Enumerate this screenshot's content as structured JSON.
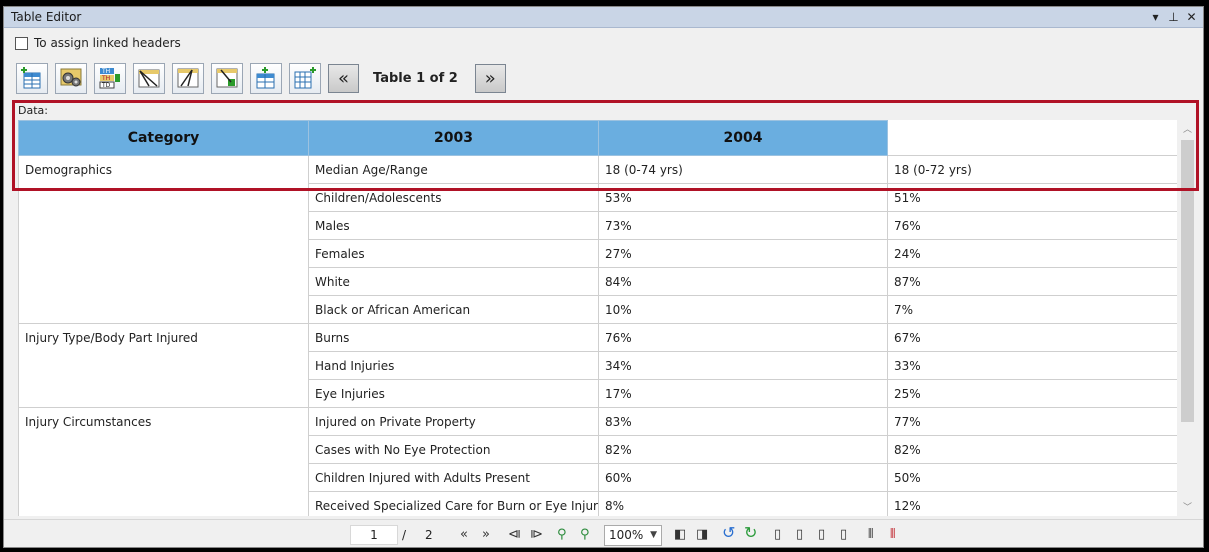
{
  "window": {
    "title": "Table Editor",
    "controls": {
      "menu": "▾",
      "pin": "⊥",
      "close": "✕"
    }
  },
  "checkbox": {
    "label": "To assign linked headers",
    "checked": false
  },
  "toolbar": {
    "table_label": "Table 1 of 2",
    "prev": "«",
    "next": "»"
  },
  "data_label": "Data:",
  "table": {
    "headers": [
      "Category",
      "2003",
      "2004"
    ],
    "groups": [
      {
        "category": "Demographics",
        "rows": [
          [
            "Median Age/Range",
            "18 (0-74 yrs)",
            "18 (0-72 yrs)"
          ],
          [
            "Children/Adolescents",
            "53%",
            "51%"
          ],
          [
            "Males",
            "73%",
            "76%"
          ],
          [
            "Females",
            "27%",
            "24%"
          ],
          [
            "White",
            "84%",
            "87%"
          ],
          [
            "Black or African American",
            "10%",
            "7%"
          ]
        ]
      },
      {
        "category": "Injury Type/Body Part Injured",
        "rows": [
          [
            "Burns",
            "76%",
            "67%"
          ],
          [
            "Hand Injuries",
            "34%",
            "33%"
          ],
          [
            "Eye Injuries",
            "17%",
            "25%"
          ]
        ]
      },
      {
        "category": "Injury Circumstances",
        "rows": [
          [
            "Injured on Private Property",
            "83%",
            "77%"
          ],
          [
            "Cases with No Eye Protection",
            "82%",
            "82%"
          ],
          [
            "Children Injured with Adults Present",
            "60%",
            "50%"
          ],
          [
            "Received Specialized Care for Burn or Eye Injuries",
            "8%",
            "12%"
          ]
        ]
      }
    ]
  },
  "pager": {
    "current_page": "1",
    "separator": "/",
    "total_pages": "2",
    "zoom": "100%"
  },
  "colors": {
    "header_bg": "#6aaee0",
    "highlight": "#b01226",
    "titlebar": "#c9d5e6"
  }
}
